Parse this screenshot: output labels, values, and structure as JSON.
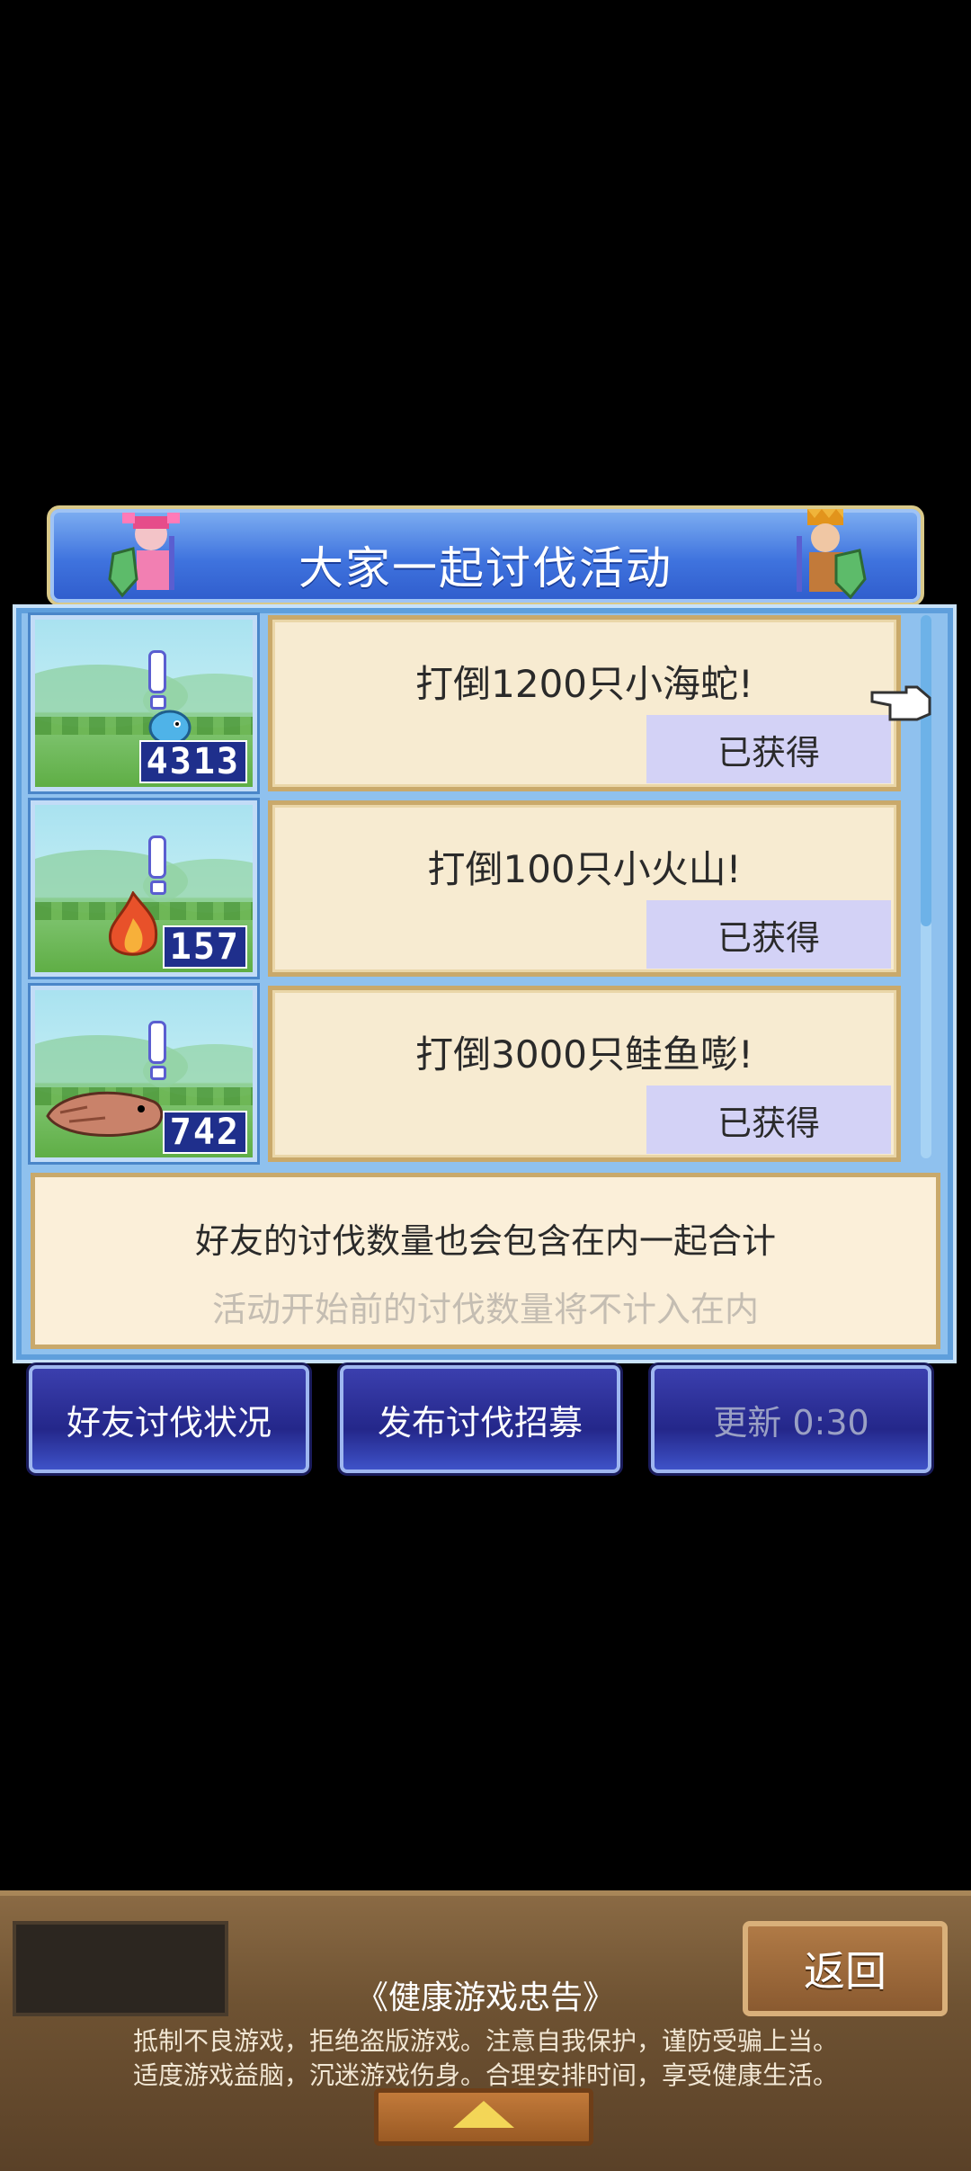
{
  "dialog": {
    "title": "大家一起讨伐活动",
    "missions": [
      {
        "text": "打倒1200只小海蛇!",
        "status": "已获得",
        "count": "4313",
        "monster": "blue-sea-snake"
      },
      {
        "text": "打倒100只小火山!",
        "status": "已获得",
        "count": "157",
        "monster": "fire-spirit"
      },
      {
        "text": "打倒3000只鲑鱼嘭!",
        "status": "已获得",
        "count": "742",
        "monster": "salmon-fish"
      }
    ],
    "notice_line1": "好友的讨伐数量也会包含在内一起合计",
    "notice_line2": "活动开始前的讨伐数量将不计入在内"
  },
  "buttons": {
    "friend_status": "好友讨伐状况",
    "post_recruit": "发布讨伐招募",
    "refresh": "更新 0:30"
  },
  "bottom_bar": {
    "back": "返回",
    "advice_title": "《健康游戏忠告》",
    "advice_line1": "抵制不良游戏，拒绝盗版游戏。注意自我保护，谨防受骗上当。",
    "advice_line2": "适度游戏益脑，沉迷游戏伤身。合理安排时间，享受健康生活。"
  },
  "colors": {
    "title_bar": "#3f73de",
    "panel": "#8fc1ee",
    "card": "#f7ebd1",
    "claimed_button": "#d3d2f6"
  }
}
